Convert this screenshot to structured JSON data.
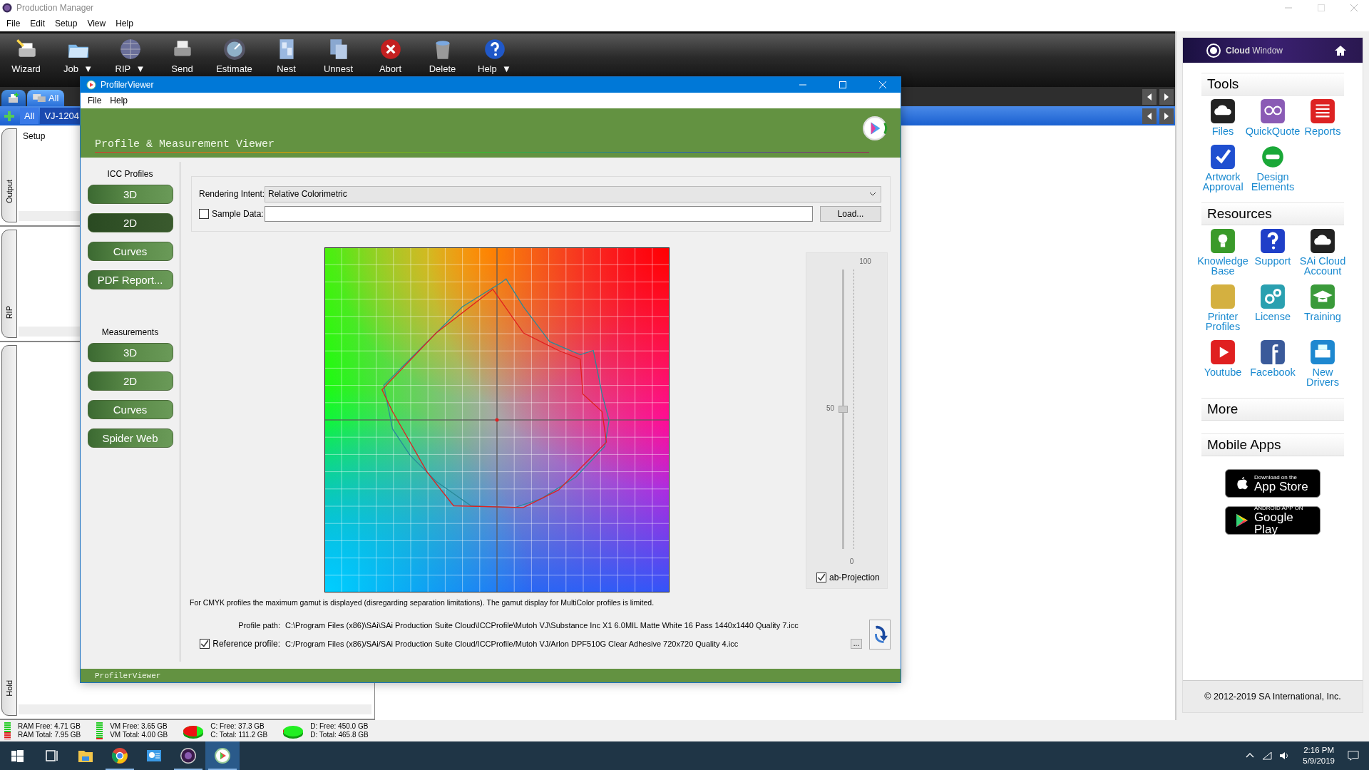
{
  "main_window": {
    "title": "Production Manager",
    "menu": [
      "File",
      "Edit",
      "Setup",
      "View",
      "Help"
    ]
  },
  "toolbar": [
    {
      "label": "Wizard"
    },
    {
      "label": "Job",
      "dropdown_mark": "▼"
    },
    {
      "label": "RIP",
      "dropdown_mark": "▼"
    },
    {
      "label": "Send"
    },
    {
      "label": "Estimate"
    },
    {
      "label": "Nest"
    },
    {
      "label": "Unnest"
    },
    {
      "label": "Abort"
    },
    {
      "label": "Delete"
    },
    {
      "label": "Help",
      "dropdown_mark": "▼"
    }
  ],
  "queue_tabs": {
    "row_1": [
      {
        "label": "All",
        "selected": true
      }
    ],
    "row_2": [
      {
        "label": "All",
        "selected": true
      },
      {
        "label": "VJ-1204",
        "selected": false
      }
    ]
  },
  "side_panels": [
    {
      "label": "Output",
      "content": "Setup"
    },
    {
      "label": "RIP"
    },
    {
      "label": "Hold"
    }
  ],
  "cloud_window": {
    "title": "**Cloud** Window",
    "sections": [
      {
        "title": "Tools",
        "items": [
          {
            "label": "Files"
          },
          {
            "label": "QuickQuote"
          },
          {
            "label": "Reports"
          },
          {
            "label": "Artwork Approval"
          },
          {
            "label": "Design Elements"
          }
        ]
      },
      {
        "title": "Resources",
        "items": [
          {
            "label": "Knowledge Base"
          },
          {
            "label": "Support"
          },
          {
            "label": "SAi Cloud Account"
          },
          {
            "label": "Printer Profiles"
          },
          {
            "label": "License"
          },
          {
            "label": "Training"
          },
          {
            "label": "Youtube"
          },
          {
            "label": "Facebook"
          },
          {
            "label": "New Drivers"
          }
        ]
      },
      {
        "title": "More"
      },
      {
        "title": "Mobile Apps"
      }
    ],
    "app_store": {
      "line_1": "Download on the",
      "line_2": "App Store"
    },
    "google_play": {
      "line_1": "ANDROID APP ON",
      "line_2": "Google Play"
    },
    "copyright": "© 2012-2019 SA International, Inc."
  },
  "status_bar": [
    {
      "kind": "bars",
      "line_1": "RAM Free: 4.71 GB",
      "line_2": "RAM Total: 7.95 GB",
      "level": 0.4
    },
    {
      "kind": "bars",
      "line_1": "VM Free: 3.65 GB",
      "line_2": "VM Total: 4.00 GB",
      "level": 0.1
    },
    {
      "kind": "pie",
      "line_1": "C: Free: 37.3 GB",
      "line_2": "C: Total: 111.2 GB",
      "level": 0.66
    },
    {
      "kind": "pie",
      "line_1": "D: Free: 450.0 GB",
      "line_2": "D: Total: 465.8 GB",
      "level": 0.03
    }
  ],
  "dialog": {
    "title": "ProfilerViewer",
    "menu": [
      "File",
      "Help"
    ],
    "header": "Profile & Measurement Viewer",
    "icc_profiles": {
      "title": "ICC Profiles",
      "buttons": [
        {
          "label": "3D",
          "selected": false
        },
        {
          "label": "2D",
          "selected": true
        },
        {
          "label": "Curves",
          "selected": false
        },
        {
          "label": "PDF Report...",
          "selected": false
        }
      ]
    },
    "measurements": {
      "title": "Measurements",
      "buttons": [
        {
          "label": "3D",
          "selected": false
        },
        {
          "label": "2D",
          "selected": false
        },
        {
          "label": "Curves",
          "selected": false
        },
        {
          "label": "Spider Web",
          "selected": false
        }
      ]
    },
    "rendering_intent": {
      "label": "Rendering Intent:",
      "value": "Relative Colorimetric"
    },
    "sample_data": {
      "label": "Sample Data:",
      "checked": false
    },
    "load_button": "Load...",
    "slider": {
      "max_label": "100",
      "mid_label": "50",
      "min_label": "0",
      "level": 0.5
    },
    "ab_projection": {
      "label": "ab-Projection",
      "checked": true
    },
    "note": "For CMYK profiles the maximum gamut is displayed (disregarding separation limitations). The gamut display for MultiColor profiles is limited.",
    "profile_path": {
      "label": "Profile path:",
      "value": "C:\\Program Files (x86)\\SAi\\SAi Production Suite Cloud\\ICCProfile\\Mutoh VJ\\Substance Inc X1 6.0MIL Matte White 16 Pass 1440x1440 Quality 7.icc"
    },
    "reference_profile": {
      "label": "Reference profile:",
      "checked": true,
      "value": "C:/Program Files (x86)/SAi/SAi Production Suite Cloud/ICCProfile/Mutoh VJ/Arlon DPF510G Clear Adhesive 720x720 Quality 4.icc"
    },
    "browse_button": "...",
    "footer": "ProfilerViewer"
  },
  "taskbar": {
    "apps": [
      {
        "running": false,
        "selected": false
      },
      {
        "running": true,
        "selected": false
      },
      {
        "running": false,
        "selected": false
      },
      {
        "running": true,
        "selected": false
      },
      {
        "running": true,
        "selected": true
      }
    ],
    "time": "2:16 PM",
    "date": "5/9/2019"
  }
}
